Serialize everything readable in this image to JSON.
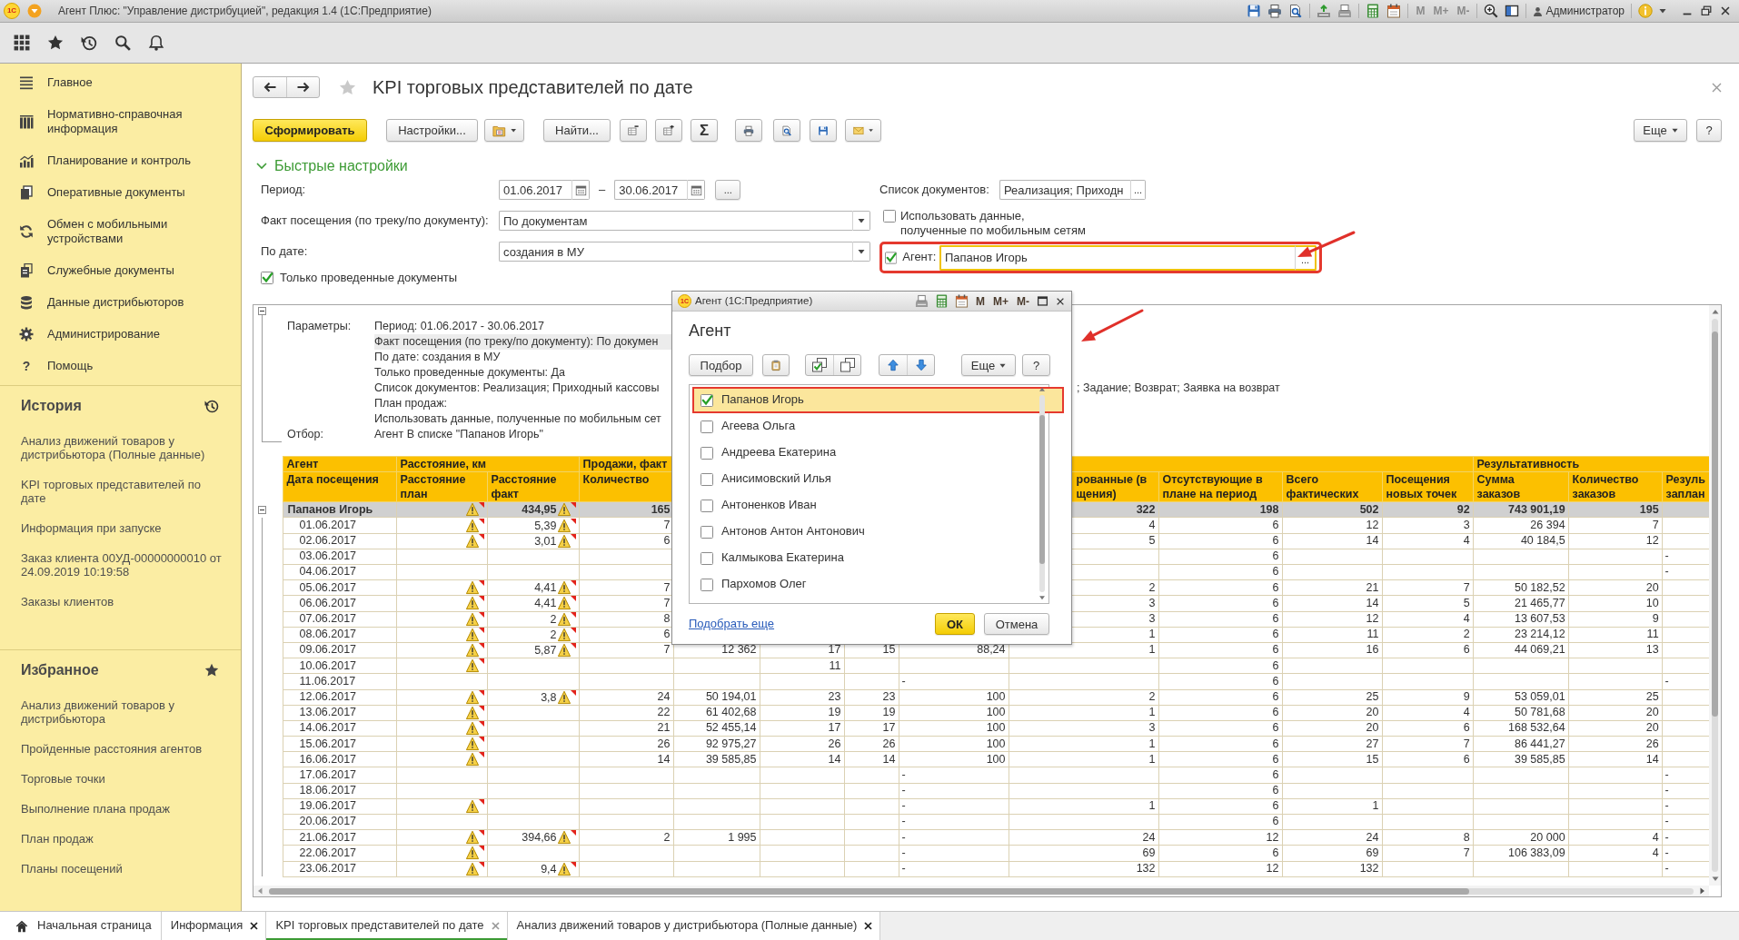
{
  "window": {
    "logo": "1С",
    "title": "Агент Плюс: \"Управление дистрибуцией\", редакция 1.4 (1С:Предприятие)",
    "memory_buttons": [
      {
        "label": "M",
        "disabled": true
      },
      {
        "label": "M+",
        "disabled": true
      },
      {
        "label": "M-",
        "disabled": true
      }
    ],
    "user": "Администратор"
  },
  "sidebar": {
    "menu": [
      {
        "label": "Главное"
      },
      {
        "label": "Нормативно-справочная информация"
      },
      {
        "label": "Планирование и контроль"
      },
      {
        "label": "Оперативные документы"
      },
      {
        "label": "Обмен с мобильными устройствами"
      },
      {
        "label": "Служебные документы"
      },
      {
        "label": "Данные дистрибьюторов"
      },
      {
        "label": "Администрирование"
      },
      {
        "label": "Помощь",
        "glyph": "?"
      }
    ],
    "history": {
      "title": "История",
      "items": [
        "Анализ движений товаров у дистрибьютора (Полные данные)",
        "KPI торговых представителей по дате",
        "Информация при запуске",
        "Заказ клиента 00УД-00000000010 от 24.09.2019 10:19:58",
        "Заказы клиентов"
      ]
    },
    "favorites": {
      "title": "Избранное",
      "items": [
        "Анализ движений товаров у дистрибьютора",
        "Пройденные расстояния агентов",
        "Торговые точки",
        "Выполнение плана продаж",
        "План продаж",
        "Планы посещений"
      ]
    }
  },
  "page": {
    "title": "KPI торговых представителей по дате",
    "favorite": false
  },
  "toolbar": {
    "generate": "Сформировать",
    "settings": "Настройки...",
    "find": "Найти...",
    "sum": "Σ",
    "more": "Еще",
    "help": "?"
  },
  "quick_settings": {
    "title": "Быстрые настройки",
    "expanded": true,
    "period": {
      "label": "Период:",
      "from": "01.06.2017",
      "dash": "–",
      "to": "30.06.2017",
      "more": "..."
    },
    "visit_fact": {
      "label": "Факт посещения (по треку/по документу):",
      "value": "По документам"
    },
    "by_date": {
      "label": "По дате:",
      "value": "создания в МУ"
    },
    "only_posted": {
      "label": "Только проведенные документы",
      "checked": true
    },
    "documents": {
      "label": "Список документов:",
      "value": "Реализация; Приходн",
      "more": "..."
    },
    "use_mobile": {
      "label": "Использовать данные,\nполученные по мобильным сетям",
      "checked": false
    },
    "agent": {
      "label": "Агент:",
      "checked": true,
      "value": "Папанов Игорь",
      "more": "...",
      "highlighted": true
    }
  },
  "report": {
    "parameters": {
      "expanded": true,
      "rows": [
        {
          "label": "Параметры:",
          "value": "Период: 01.06.2017 - 30.06.2017",
          "selected": false
        },
        {
          "value": "Факт посещения (по треку/по документу): По докумен",
          "selected": true
        },
        {
          "value": "По дате: создания в МУ",
          "selected": false
        },
        {
          "value": "Только проведенные документы: Да",
          "selected": false
        },
        {
          "value": "Список документов: Реализация; Приходный кассовы",
          "continuation": "; Задание; Возврат; Заявка на возврат",
          "selected": false
        },
        {
          "value": "План продаж:",
          "selected": false
        },
        {
          "value": "Использовать данные, полученные по мобильным сет",
          "selected": false
        },
        {
          "label": "Отбор:",
          "value": "Агент В списке \"Папанов Игорь\"",
          "selected": false
        }
      ]
    },
    "table": {
      "column_groups": [
        {
          "label": "Агент",
          "columns": [
            {
              "label": "Дата посещения"
            }
          ]
        },
        {
          "label": "Расстояние, км",
          "columns": [
            {
              "label": "Расстояние\nплан"
            },
            {
              "label": "Расстояние\nфакт"
            }
          ]
        },
        {
          "label": "Продажи, факт",
          "columns": [
            {
              "label": "Количество"
            },
            null,
            null,
            null,
            null,
            {
              "label": "рованные (в\nщения)"
            },
            {
              "label": "Отсутствующие в\nплане на период"
            },
            {
              "label": "Всего\nфактических"
            },
            {
              "label": "Посещения\nновых точек"
            }
          ]
        },
        {
          "label": "Результативность",
          "columns": [
            {
              "label": "Сумма\nзаказов"
            },
            {
              "label": "Количество\nзаказов"
            },
            {
              "label": "Резуль\nзаплан"
            }
          ]
        }
      ],
      "rows": [
        {
          "cells": [
            "Папанов Игорь",
            {
              "warning": true
            },
            {
              "text": "434,95",
              "warning": true
            },
            "165",
            null,
            null,
            null,
            null,
            "322",
            "198",
            "502",
            "92",
            "743 901,19",
            "195",
            null
          ],
          "expanded": true,
          "children": [
            {
              "cells": [
                "01.06.2017",
                {
                  "warning": true
                },
                {
                  "text": "5,39",
                  "warning": true
                },
                "7",
                null,
                null,
                null,
                null,
                "4",
                "6",
                "12",
                "3",
                "26 394",
                "7",
                null
              ]
            },
            {
              "cells": [
                "02.06.2017",
                {
                  "warning": true
                },
                {
                  "text": "3,01",
                  "warning": true
                },
                "6",
                null,
                null,
                null,
                null,
                "5",
                "6",
                "14",
                "4",
                "40 184,5",
                "12",
                null
              ]
            },
            {
              "cells": [
                "03.06.2017",
                null,
                null,
                null,
                null,
                null,
                null,
                null,
                null,
                "6",
                null,
                null,
                null,
                null,
                "-"
              ]
            },
            {
              "cells": [
                "04.06.2017",
                null,
                null,
                null,
                null,
                null,
                null,
                null,
                null,
                "6",
                null,
                null,
                null,
                null,
                "-"
              ]
            },
            {
              "cells": [
                "05.06.2017",
                {
                  "warning": true
                },
                {
                  "text": "4,41",
                  "warning": true
                },
                "7",
                null,
                null,
                null,
                null,
                "2",
                "6",
                "21",
                "7",
                "50 182,52",
                "20",
                null
              ]
            },
            {
              "cells": [
                "06.06.2017",
                {
                  "warning": true
                },
                {
                  "text": "4,41",
                  "warning": true
                },
                "7",
                null,
                null,
                null,
                null,
                "3",
                "6",
                "14",
                "5",
                "21 465,77",
                "10",
                null
              ]
            },
            {
              "cells": [
                "07.06.2017",
                {
                  "warning": true
                },
                {
                  "text": "2",
                  "warning": true
                },
                "8",
                null,
                null,
                null,
                null,
                "3",
                "6",
                "12",
                "4",
                "13 607,53",
                "9",
                null
              ]
            },
            {
              "cells": [
                "08.06.2017",
                {
                  "warning": true
                },
                {
                  "text": "2",
                  "warning": true
                },
                "6",
                null,
                null,
                null,
                null,
                "1",
                "6",
                "11",
                "2",
                "23 214,12",
                "11",
                null
              ]
            },
            {
              "cells": [
                "09.06.2017",
                {
                  "warning": true
                },
                {
                  "text": "5,87",
                  "warning": true
                },
                "7",
                "12 362",
                "17",
                "15",
                "88,24",
                "1",
                "6",
                "16",
                "6",
                "44 069,21",
                "13",
                null
              ]
            },
            {
              "cells": [
                "10.06.2017",
                {
                  "warning": true
                },
                null,
                null,
                null,
                "11",
                null,
                null,
                null,
                "6",
                null,
                null,
                null,
                null,
                null
              ]
            },
            {
              "cells": [
                "11.06.2017",
                null,
                null,
                null,
                null,
                null,
                null,
                "-",
                null,
                "6",
                null,
                null,
                null,
                null,
                "-"
              ]
            },
            {
              "cells": [
                "12.06.2017",
                {
                  "warning": true
                },
                {
                  "text": "3,8",
                  "warning": true
                },
                "24",
                "50 194,01",
                "23",
                "23",
                "100",
                "2",
                "6",
                "25",
                "9",
                "53 059,01",
                "25",
                null
              ]
            },
            {
              "cells": [
                "13.06.2017",
                {
                  "warning": true
                },
                null,
                "22",
                "61 402,68",
                "19",
                "19",
                "100",
                "1",
                "6",
                "20",
                "4",
                "50 781,68",
                "20",
                null
              ]
            },
            {
              "cells": [
                "14.06.2017",
                {
                  "warning": true
                },
                null,
                "21",
                "52 455,14",
                "17",
                "17",
                "100",
                "3",
                "6",
                "20",
                "6",
                "168 532,64",
                "20",
                null
              ]
            },
            {
              "cells": [
                "15.06.2017",
                {
                  "warning": true
                },
                null,
                "26",
                "92 975,27",
                "26",
                "26",
                "100",
                "1",
                "6",
                "27",
                "7",
                "86 441,27",
                "26",
                null
              ]
            },
            {
              "cells": [
                "16.06.2017",
                {
                  "warning": true
                },
                null,
                "14",
                "39 585,85",
                "14",
                "14",
                "100",
                "1",
                "6",
                "15",
                "6",
                "39 585,85",
                "14",
                null
              ]
            },
            {
              "cells": [
                "17.06.2017",
                null,
                null,
                null,
                null,
                null,
                null,
                "-",
                null,
                "6",
                null,
                null,
                null,
                null,
                "-"
              ]
            },
            {
              "cells": [
                "18.06.2017",
                null,
                null,
                null,
                null,
                null,
                null,
                "-",
                null,
                "6",
                null,
                null,
                null,
                null,
                "-"
              ]
            },
            {
              "cells": [
                "19.06.2017",
                {
                  "warning": true
                },
                null,
                null,
                null,
                null,
                null,
                "-",
                "1",
                "6",
                "1",
                null,
                null,
                null,
                "-"
              ]
            },
            {
              "cells": [
                "20.06.2017",
                null,
                null,
                null,
                null,
                null,
                null,
                "-",
                null,
                "6",
                null,
                null,
                null,
                null,
                "-"
              ]
            },
            {
              "cells": [
                "21.06.2017",
                {
                  "warning": true
                },
                {
                  "text": "394,66",
                  "warning": true
                },
                "2",
                "1 995",
                null,
                null,
                "-",
                "24",
                "12",
                "24",
                "8",
                "20 000",
                "4",
                "-"
              ]
            },
            {
              "cells": [
                "22.06.2017",
                {
                  "warning": true
                },
                null,
                null,
                null,
                null,
                null,
                "-",
                "69",
                "6",
                "69",
                "7",
                "106 383,09",
                "4",
                "-"
              ]
            },
            {
              "cells": [
                "23.06.2017",
                {
                  "warning": true
                },
                {
                  "text": "9,4",
                  "warning": true
                },
                null,
                null,
                null,
                null,
                "-",
                "132",
                "12",
                "132",
                null,
                null,
                null,
                "-"
              ]
            }
          ]
        }
      ]
    }
  },
  "dialog": {
    "logo": "1С",
    "title": "Агент (1С:Предприятие)",
    "memory_buttons": [
      {
        "label": "M",
        "disabled": false
      },
      {
        "label": "M+",
        "disabled": false
      },
      {
        "label": "M-",
        "disabled": false
      }
    ],
    "heading": "Агент",
    "highlighted": true,
    "pick": "Подбор",
    "more": "Еще",
    "help": "?",
    "items": [
      {
        "label": "Папанов Игорь",
        "checked": true,
        "selected": true,
        "highlighted": true
      },
      {
        "label": "Агеева Ольга",
        "checked": false,
        "selected": false,
        "highlighted": false
      },
      {
        "label": "Андреева Екатерина",
        "checked": false,
        "selected": false,
        "highlighted": false
      },
      {
        "label": "Анисимовский Илья",
        "checked": false,
        "selected": false,
        "highlighted": false
      },
      {
        "label": "Антоненков Иван",
        "checked": false,
        "selected": false,
        "highlighted": false
      },
      {
        "label": "Антонов Антон Антонович",
        "checked": false,
        "selected": false,
        "highlighted": false
      },
      {
        "label": "Калмыкова Екатерина",
        "checked": false,
        "selected": false,
        "highlighted": false
      },
      {
        "label": "Пархомов Олег",
        "checked": false,
        "selected": false,
        "highlighted": false
      }
    ],
    "link": "Подобрать еще",
    "ok": "ОК",
    "cancel": "Отмена"
  },
  "tabs": [
    {
      "kind": "home",
      "label": "Начальная страница",
      "selected": false,
      "closable": false
    },
    {
      "kind": "page",
      "label": "Информация",
      "selected": false,
      "closable": true
    },
    {
      "kind": "page",
      "label": "KPI торговых представителей по дате",
      "selected": true,
      "closable": true
    },
    {
      "kind": "page",
      "label": "Анализ движений товаров у дистрибьютора (Полные данные)",
      "selected": false,
      "closable": true
    }
  ]
}
